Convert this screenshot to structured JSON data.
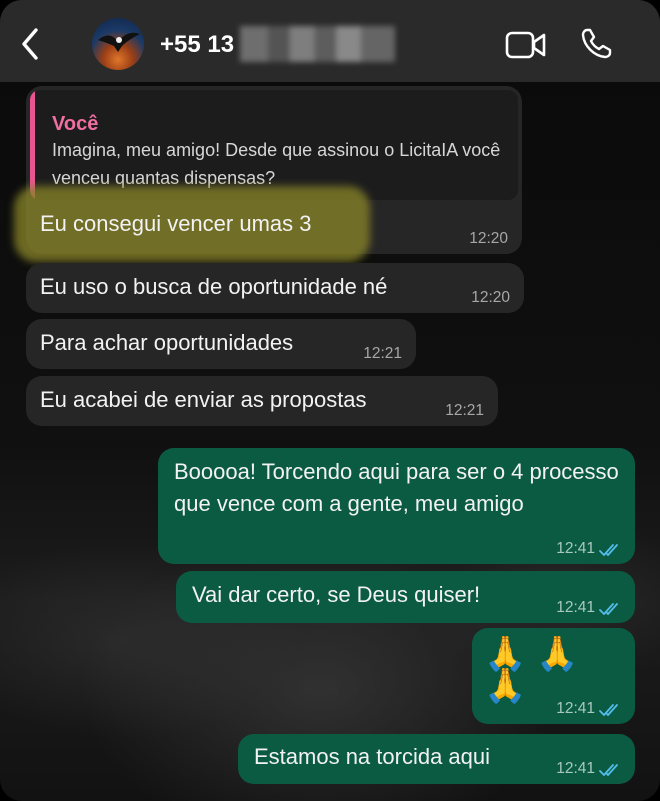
{
  "header": {
    "contact": "+55 13",
    "video_icon": "video-call-icon",
    "call_icon": "phone-icon",
    "back_icon": "chevron-left-icon"
  },
  "messages": [
    {
      "direction": "in",
      "quote": {
        "author": "Você",
        "text": "Imagina, meu amigo! Desde que assinou o LicitaIA você venceu quantas dispensas?"
      },
      "text": "Eu consegui vencer umas 3",
      "time": "12:20",
      "highlighted": true
    },
    {
      "direction": "in",
      "text": "Eu uso o busca de oportunidade né",
      "time": "12:20"
    },
    {
      "direction": "in",
      "text": "Para achar oportunidades",
      "time": "12:21"
    },
    {
      "direction": "in",
      "text": "Eu acabei de enviar as propostas",
      "time": "12:21"
    },
    {
      "direction": "out",
      "text": "Booooa! Torcendo aqui para ser o 4 processo que vence com a gente, meu amigo",
      "time": "12:41",
      "status": "read"
    },
    {
      "direction": "out",
      "text": "Vai dar certo, se Deus quiser!",
      "time": "12:41",
      "status": "read"
    },
    {
      "direction": "out",
      "text": "🙏🙏🙏",
      "time": "12:41",
      "status": "read"
    },
    {
      "direction": "out",
      "text": "Estamos na torcida aqui",
      "time": "12:41",
      "status": "read"
    }
  ],
  "colors": {
    "incoming_bubble": "#262627",
    "outgoing_bubble": "#0b5b43",
    "quote_accent": "#e8558f",
    "read_ticks": "#53bdeb",
    "highlight": "#868328"
  }
}
